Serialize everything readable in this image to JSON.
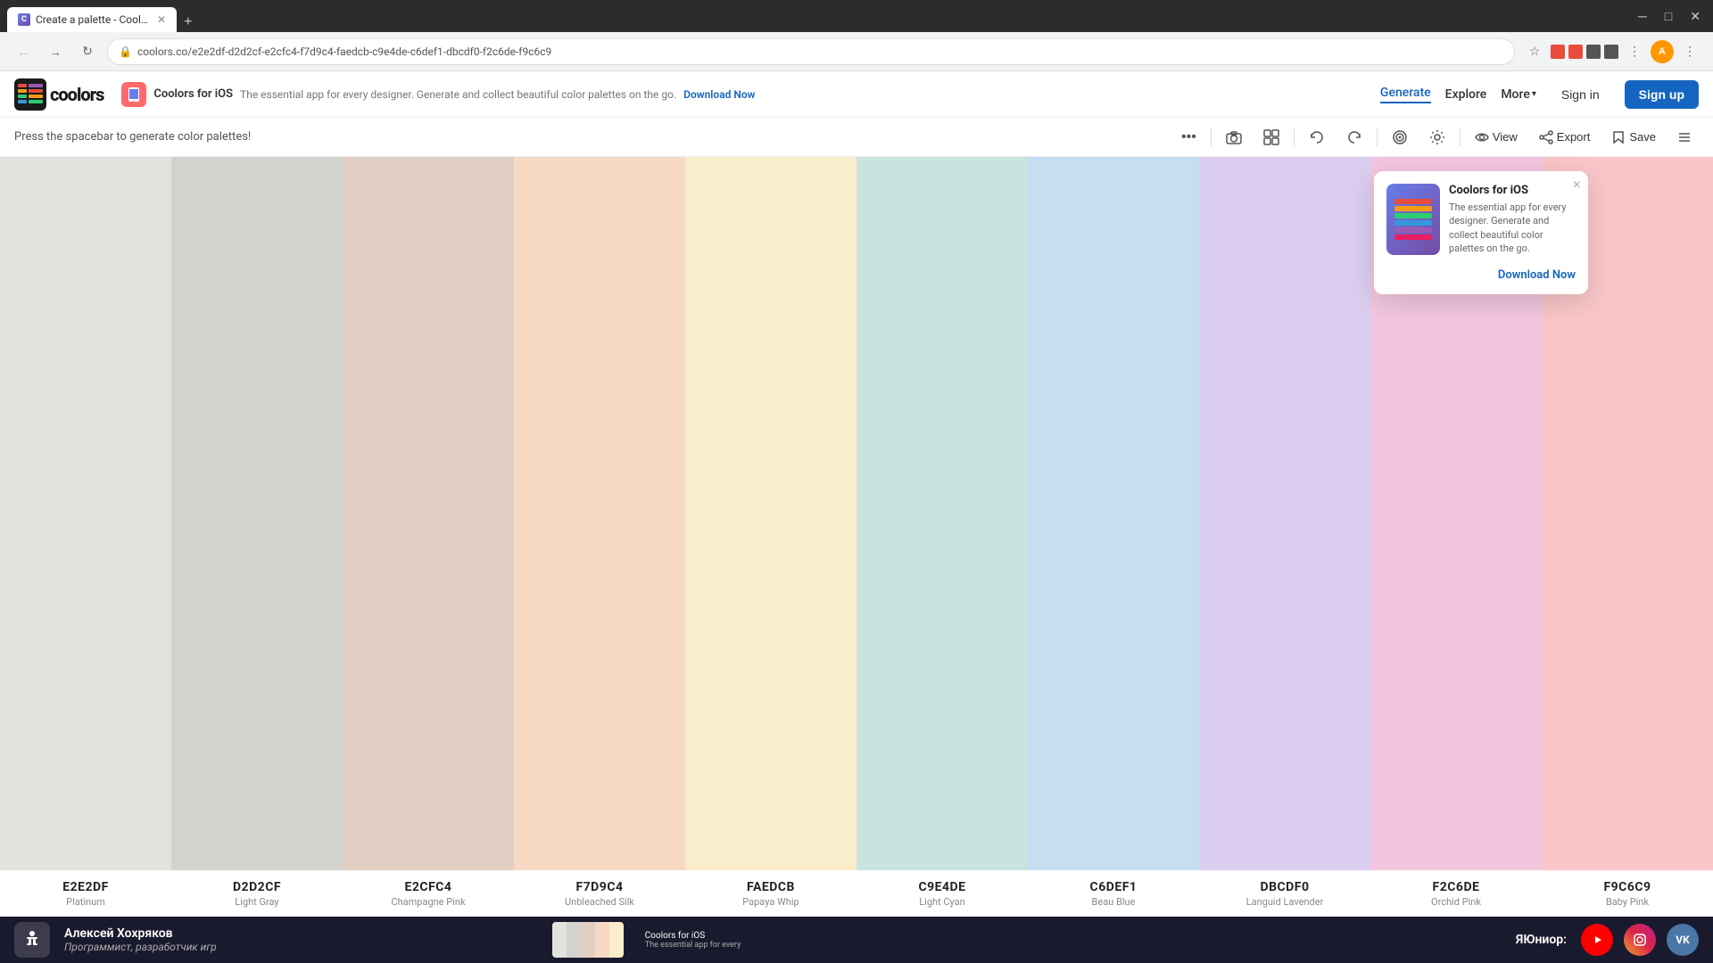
{
  "browser": {
    "tab_title": "Create a palette - Coolors",
    "url": "coolors.co/e2e2df-d2d2cf-e2cfc4-f7d9c4-faedcb-c9e4de-c6def1-dbcdf0-f2c6de-f9c6c9",
    "favicon_color": "#4285f4",
    "new_tab_label": "+",
    "back_disabled": true,
    "forward_disabled": false
  },
  "navbar": {
    "logo_text": "coolors",
    "ios_promo": {
      "app_name": "Coolors for iOS",
      "description": "The essential app for every designer. Generate and collect beautiful color palettes on the go.",
      "download_label": "Download Now"
    },
    "nav_links": [
      {
        "label": "Generate",
        "active": true
      },
      {
        "label": "Explore",
        "active": false
      },
      {
        "label": "More",
        "has_arrow": true,
        "active": false
      }
    ],
    "signin_label": "Sign in",
    "signup_label": "Sign up"
  },
  "toolbar": {
    "hint": "Press the spacebar to generate color palettes!",
    "actions": {
      "more_label": "...",
      "camera_label": "📷",
      "grid_label": "⊞",
      "undo_label": "↩",
      "redo_label": "↪",
      "adjust_label": "🎨",
      "settings_label": "⚙",
      "view_label": "View",
      "export_label": "Export",
      "save_label": "Save",
      "menu_label": "☰"
    }
  },
  "colors": [
    {
      "hex": "E2E2DF",
      "name": "Platinum",
      "color": "#E2E2DF"
    },
    {
      "hex": "D2D2CF",
      "name": "Light Gray",
      "color": "#D2D2CF"
    },
    {
      "hex": "E2CFC4",
      "name": "Champagne Pink",
      "color": "#E2CFC4"
    },
    {
      "hex": "F7D9C4",
      "name": "Unbleached Silk",
      "color": "#F7D9C4"
    },
    {
      "hex": "FAEDCB",
      "name": "Papaya Whip",
      "color": "#FAEDCB"
    },
    {
      "hex": "C9E4DE",
      "name": "Light Cyan",
      "color": "#C9E4DE"
    },
    {
      "hex": "C6DEF1",
      "name": "Beau Blue",
      "color": "#C6DEF1"
    },
    {
      "hex": "DBCDF0",
      "name": "Languid Lavender",
      "color": "#DBCDF0"
    },
    {
      "hex": "F2C6DE",
      "name": "Orchid Pink",
      "color": "#F2C6DE"
    },
    {
      "hex": "F9C6C9",
      "name": "Baby Pink",
      "color": "#F9C6C9"
    }
  ],
  "ios_popup": {
    "title": "Coolors for iOS",
    "description": "The essential app for every designer. Generate and collect beautiful color palettes on the go.",
    "download_label": "Download Now",
    "close_label": "×",
    "preview_colors": [
      "#FF6B6B",
      "#4ECDC4",
      "#45B7D1",
      "#96CEB4",
      "#FFEAA7",
      "#DDA0DD"
    ]
  },
  "taskbar": {
    "icon_char": "🏋",
    "name": "Алексей Хохряков",
    "subtitle": "Программист, разработчик игр",
    "brand_label": "ЯЮниор:",
    "social": {
      "youtube_label": "▶",
      "instagram_label": "ig",
      "vk_label": "VK"
    },
    "thumb_colors": [
      "#E2E2DF",
      "#D2D2CF",
      "#E2CFC4",
      "#F7D9C4",
      "#FAEDCB"
    ]
  }
}
